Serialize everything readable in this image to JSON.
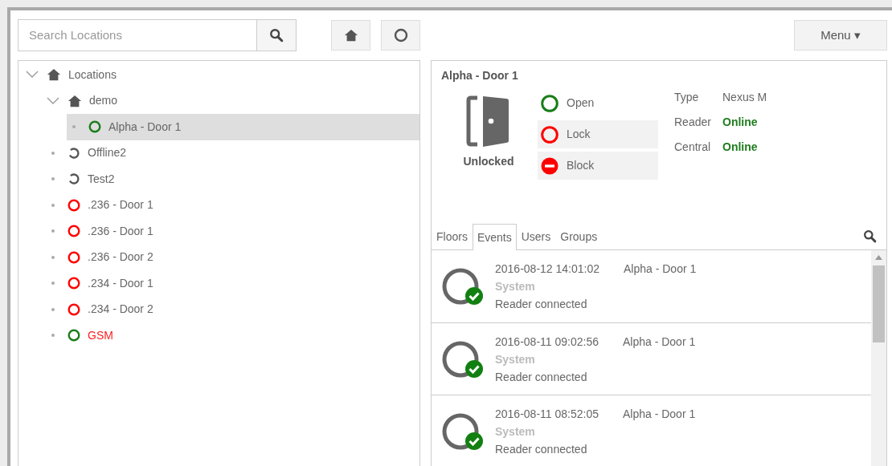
{
  "search": {
    "placeholder": "Search Locations"
  },
  "menu_button": {
    "label": "Menu ▾"
  },
  "tree": [
    {
      "label": "Locations",
      "kind": "folder",
      "expanded": true,
      "selected": false,
      "warning": false,
      "children": [
        {
          "label": "demo",
          "kind": "folder",
          "expanded": true,
          "selected": false,
          "warning": false,
          "children": [
            {
              "label": "Alpha - Door 1",
              "kind": "open",
              "selected": true,
              "warning": false
            }
          ]
        },
        {
          "label": "Offline2",
          "kind": "offline",
          "selected": false,
          "warning": false
        },
        {
          "label": "Test2",
          "kind": "offline",
          "selected": false,
          "warning": false
        },
        {
          "label": ".236 - Door 1",
          "kind": "locked",
          "selected": false,
          "warning": false
        },
        {
          "label": ".236 - Door 1",
          "kind": "locked",
          "selected": false,
          "warning": false
        },
        {
          "label": ".236 - Door 2",
          "kind": "locked",
          "selected": false,
          "warning": false
        },
        {
          "label": ".234 - Door 1",
          "kind": "locked",
          "selected": false,
          "warning": false
        },
        {
          "label": ".234 - Door 2",
          "kind": "locked",
          "selected": false,
          "warning": false
        },
        {
          "label": "GSM",
          "kind": "open",
          "selected": false,
          "warning": true
        }
      ]
    }
  ],
  "detail": {
    "title": "Alpha - Door 1",
    "state": "Unlocked",
    "actions": [
      {
        "label": "Open",
        "kind": "open",
        "current": true
      },
      {
        "label": "Lock",
        "kind": "lock",
        "current": false
      },
      {
        "label": "Block",
        "kind": "block",
        "current": false
      }
    ],
    "info": [
      {
        "label": "Type",
        "value": "Nexus M",
        "kind": "plain"
      },
      {
        "label": "Reader",
        "value": "Online",
        "kind": "online"
      },
      {
        "label": "Central",
        "value": "Online",
        "kind": "online"
      }
    ]
  },
  "tabs": [
    {
      "label": "Floors",
      "selected": false
    },
    {
      "label": "Events",
      "selected": true
    },
    {
      "label": "Users",
      "selected": false
    },
    {
      "label": "Groups",
      "selected": false
    }
  ],
  "events": [
    {
      "time": "2016-08-12 14:01:02",
      "door": "Alpha - Door 1",
      "source": "System",
      "message": "Reader connected"
    },
    {
      "time": "2016-08-11 09:02:56",
      "door": "Alpha - Door 1",
      "source": "System",
      "message": "Reader connected"
    },
    {
      "time": "2016-08-11 08:52:05",
      "door": "Alpha - Door 1",
      "source": "System",
      "message": "Reader connected"
    }
  ]
}
